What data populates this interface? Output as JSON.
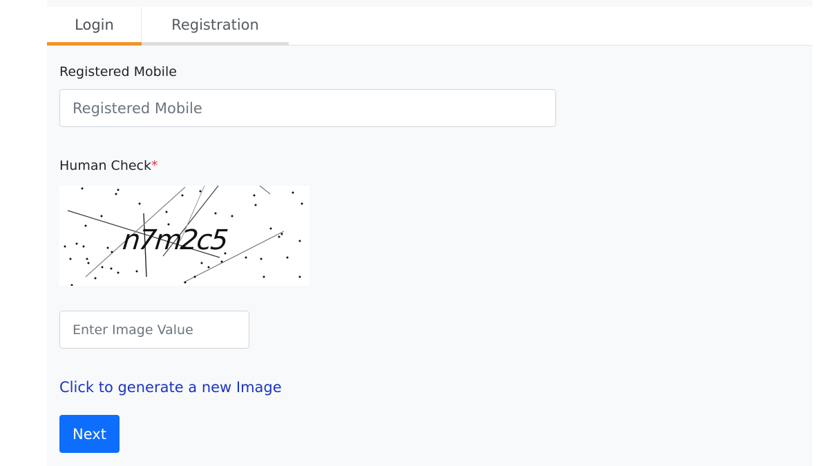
{
  "tabs": {
    "login": "Login",
    "registration": "Registration"
  },
  "form": {
    "mobile_label": "Registered Mobile",
    "mobile_placeholder": "Registered Mobile",
    "mobile_value": "",
    "human_check_label": "Human Check",
    "required_mark": "*",
    "captcha_text": "n7m2c5",
    "captcha_placeholder": "Enter Image Value",
    "captcha_value": "",
    "refresh_link": "Click to generate a new Image",
    "next_label": "Next"
  },
  "colors": {
    "active_tab": "#f39325",
    "primary_button": "#0d6efd",
    "link": "#1a35c4",
    "required": "#dc3545"
  }
}
